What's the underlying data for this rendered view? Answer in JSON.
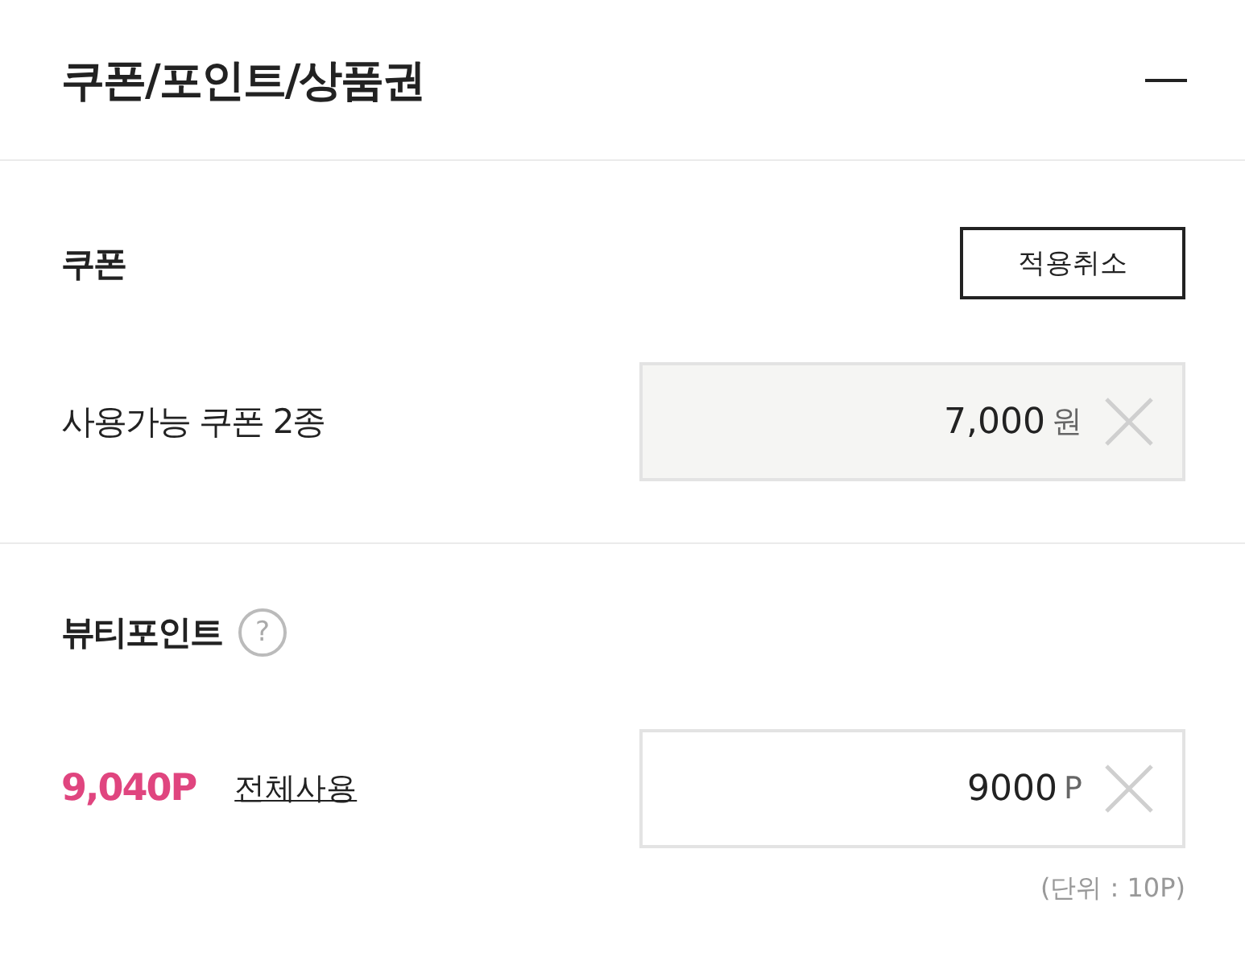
{
  "header": {
    "title": "쿠폰/포인트/상품권",
    "expanded": true
  },
  "coupon": {
    "title": "쿠폰",
    "cancel_button": "적용취소",
    "label": "사용가능 쿠폰 2종",
    "field": {
      "value": "7,000",
      "unit": "원",
      "disabled": true
    }
  },
  "points": {
    "title": "뷰티포인트",
    "help": "?",
    "balance": "9,040P",
    "use_all_link": "전체사용",
    "field": {
      "value": "9000",
      "unit": "P",
      "disabled": false
    },
    "note": "(단위 : 10P)"
  }
}
